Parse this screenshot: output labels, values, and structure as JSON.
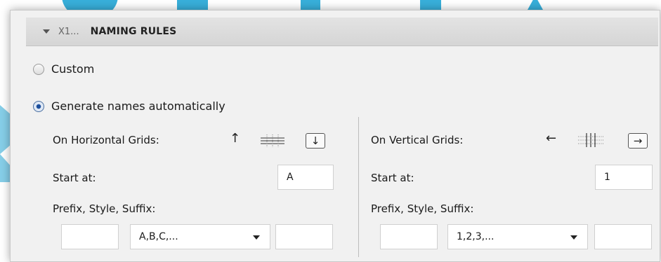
{
  "header": {
    "prefix": "X1...",
    "title": "NAMING RULES"
  },
  "options": {
    "custom_label": "Custom",
    "auto_label": "Generate names automatically",
    "selected": "auto"
  },
  "horizontal": {
    "title": "On Horizontal Grids:",
    "direction_arrow": "↑",
    "toggle_arrow": "↓",
    "grid_icon": "horizontal-grid-icon",
    "start_label": "Start at:",
    "start_value": "A",
    "pss_label": "Prefix, Style, Suffix:",
    "prefix_value": "",
    "style_value": "A,B,C,...",
    "suffix_value": ""
  },
  "vertical": {
    "title": "On Vertical Grids:",
    "direction_arrow": "←",
    "toggle_arrow": "→",
    "grid_icon": "vertical-grid-icon",
    "start_label": "Start at:",
    "start_value": "1",
    "pss_label": "Prefix, Style, Suffix:",
    "prefix_value": "",
    "style_value": "1,2,3,...",
    "suffix_value": ""
  }
}
